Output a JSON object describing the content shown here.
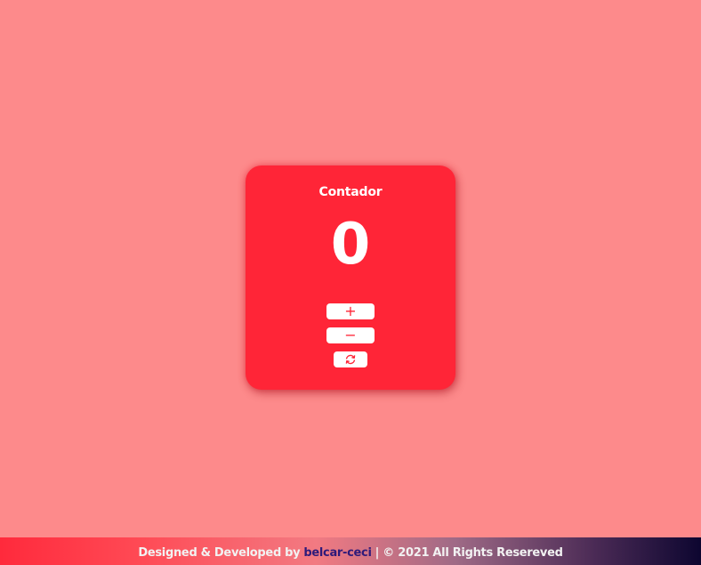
{
  "counter": {
    "title": "Contador",
    "value": "0",
    "increment_label": "+",
    "decrement_label": "−",
    "reset_icon": "refresh-icon"
  },
  "footer": {
    "prefix": "Designed & Developed by",
    "author": "belcar-ceci",
    "suffix": "| © 2021 All Rights Resereved"
  },
  "colors": {
    "background": "#fd8a8b",
    "card": "#ff2537",
    "button": "#ffffff",
    "author_link": "#2f1a7a"
  }
}
